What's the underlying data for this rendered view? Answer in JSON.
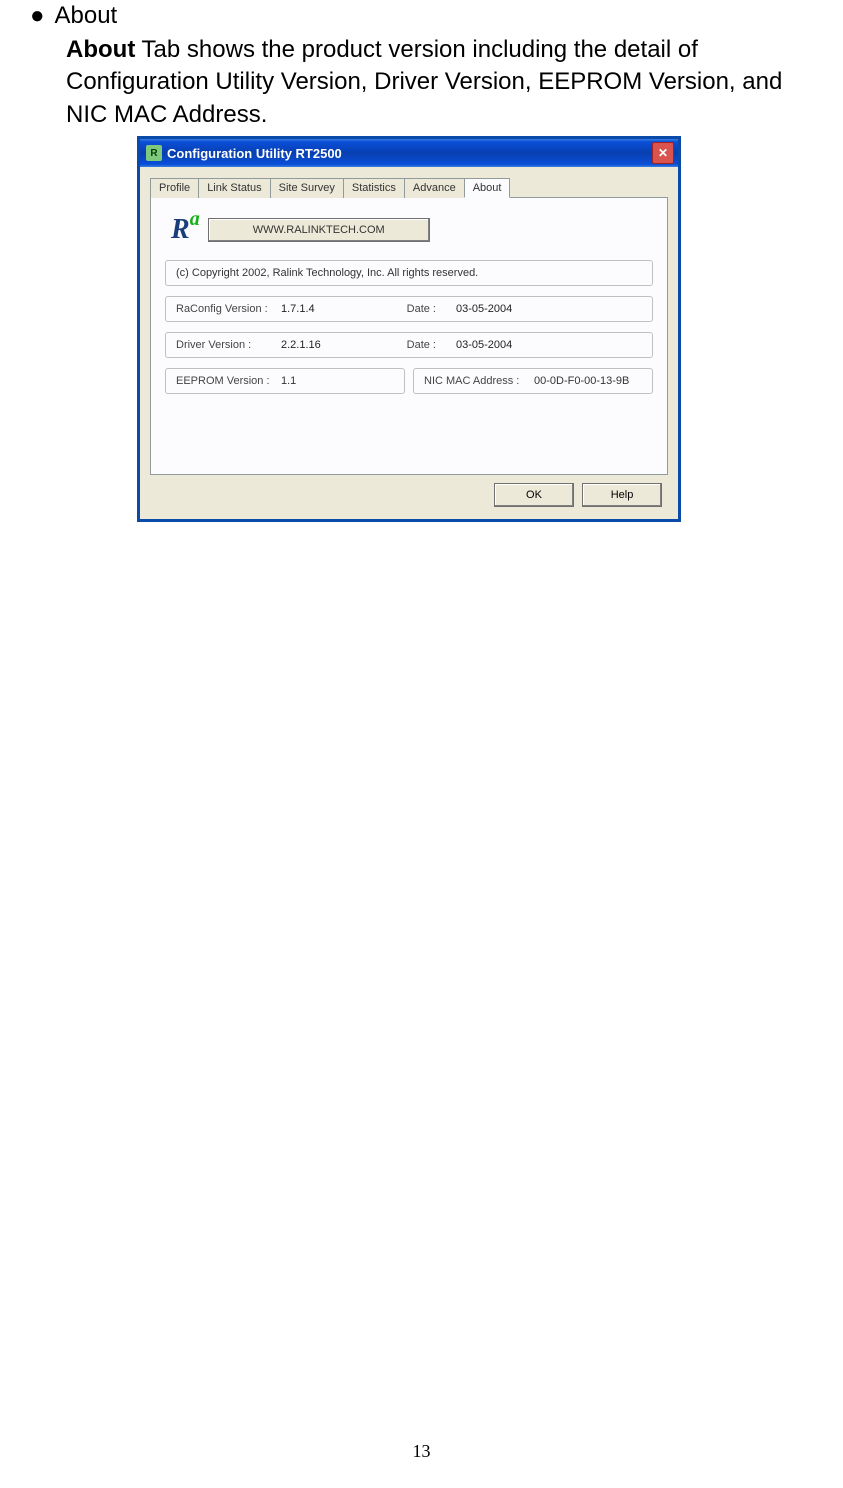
{
  "bullet_heading": "About",
  "para_bold": "About",
  "para_rest": " Tab shows the product version including the detail of Configuration Utility Version, Driver Version, EEPROM Version, and NIC MAC Address.",
  "window": {
    "title": "Configuration Utility RT2500",
    "tabs": [
      "Profile",
      "Link Status",
      "Site Survey",
      "Statistics",
      "Advance",
      "About"
    ],
    "active_tab": "About",
    "www_button": "WWW.RALINKTECH.COM",
    "copyright": "(c) Copyright 2002, Ralink Technology, Inc.  All rights reserved.",
    "raconfig": {
      "label": "RaConfig Version :",
      "value": "1.7.1.4",
      "date_label": "Date :",
      "date_value": "03-05-2004"
    },
    "driver": {
      "label": "Driver Version :",
      "value": "2.2.1.16",
      "date_label": "Date :",
      "date_value": "03-05-2004"
    },
    "eeprom": {
      "label": "EEPROM Version :",
      "value": "1.1"
    },
    "nic": {
      "label": "NIC MAC Address :",
      "value": "00-0D-F0-00-13-9B"
    },
    "ok_button": "OK",
    "help_button": "Help"
  },
  "page_number": "13"
}
